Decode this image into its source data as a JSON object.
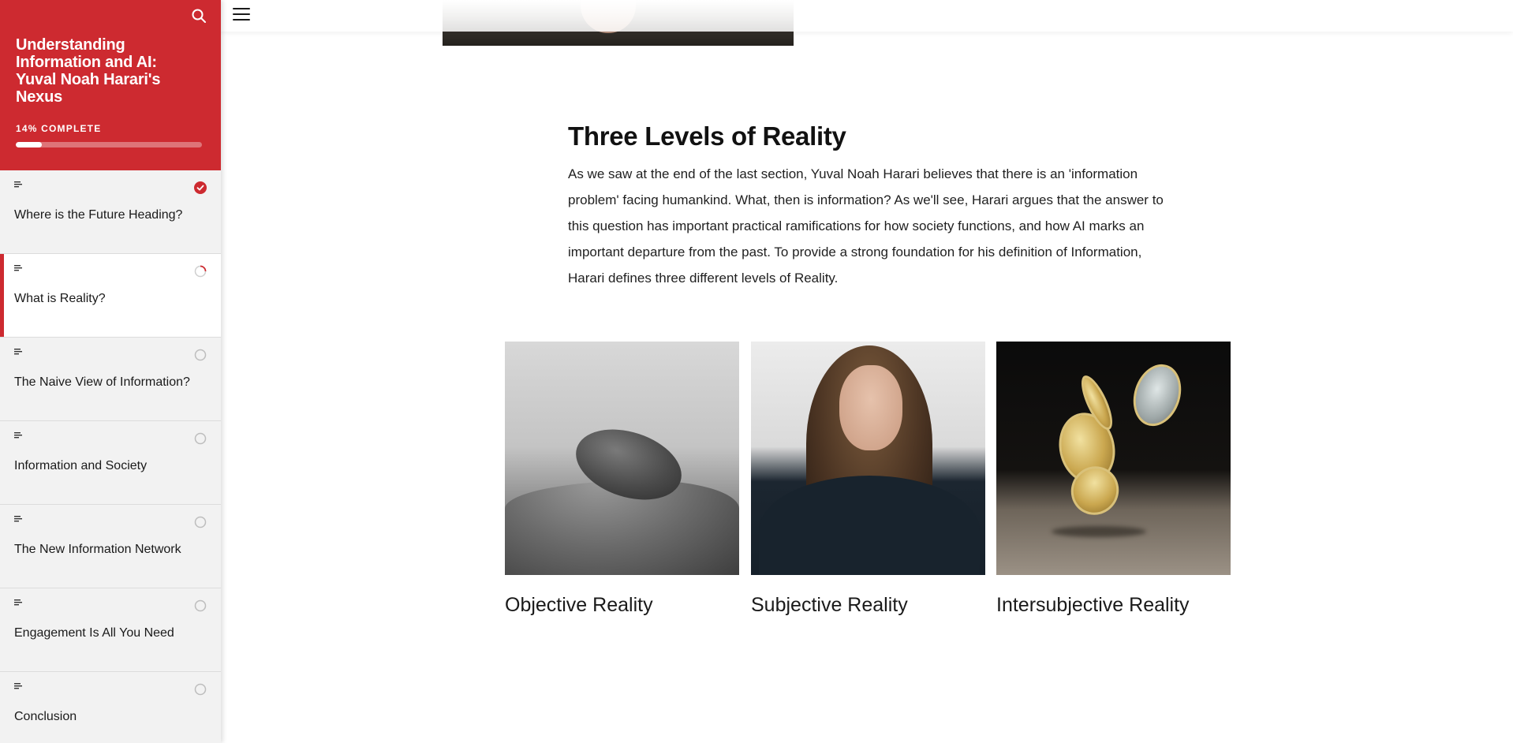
{
  "sidebar": {
    "title": "Understanding Information and AI: Yuval Noah Harari's Nexus",
    "progress_label": "14% COMPLETE",
    "progress_fraction": 0.14,
    "search_icon": "search-icon",
    "accent_color": "#cd2a30",
    "lessons": [
      {
        "title": "Where is the Future Heading?",
        "status": "complete"
      },
      {
        "title": "What is Reality?",
        "status": "in-progress"
      },
      {
        "title": "The Naive View of Information?",
        "status": "not-started"
      },
      {
        "title": "Information and Society",
        "status": "not-started"
      },
      {
        "title": "The New Information Network",
        "status": "not-started"
      },
      {
        "title": "Engagement Is All You Need",
        "status": "not-started"
      },
      {
        "title": "Conclusion",
        "status": "not-started"
      }
    ]
  },
  "topbar": {
    "menu_icon": "hamburger-menu-icon"
  },
  "main": {
    "heading": "Three Levels of Reality",
    "body": "As we saw at the end of the last section, Yuval Noah Harari believes that there is an 'information problem' facing humankind. What, then is information? As we'll see, Harari argues that the answer to this question has important practical ramifications for how society functions, and how AI marks an important departure from the past. To provide a strong foundation for his definition of Information, Harari defines three different levels of Reality.",
    "cards": [
      {
        "label": "Objective Reality",
        "image": "stone-on-sand-photo"
      },
      {
        "label": "Subjective Reality",
        "image": "laughing-woman-photo"
      },
      {
        "label": "Intersubjective Reality",
        "image": "falling-coins-photo"
      }
    ]
  }
}
